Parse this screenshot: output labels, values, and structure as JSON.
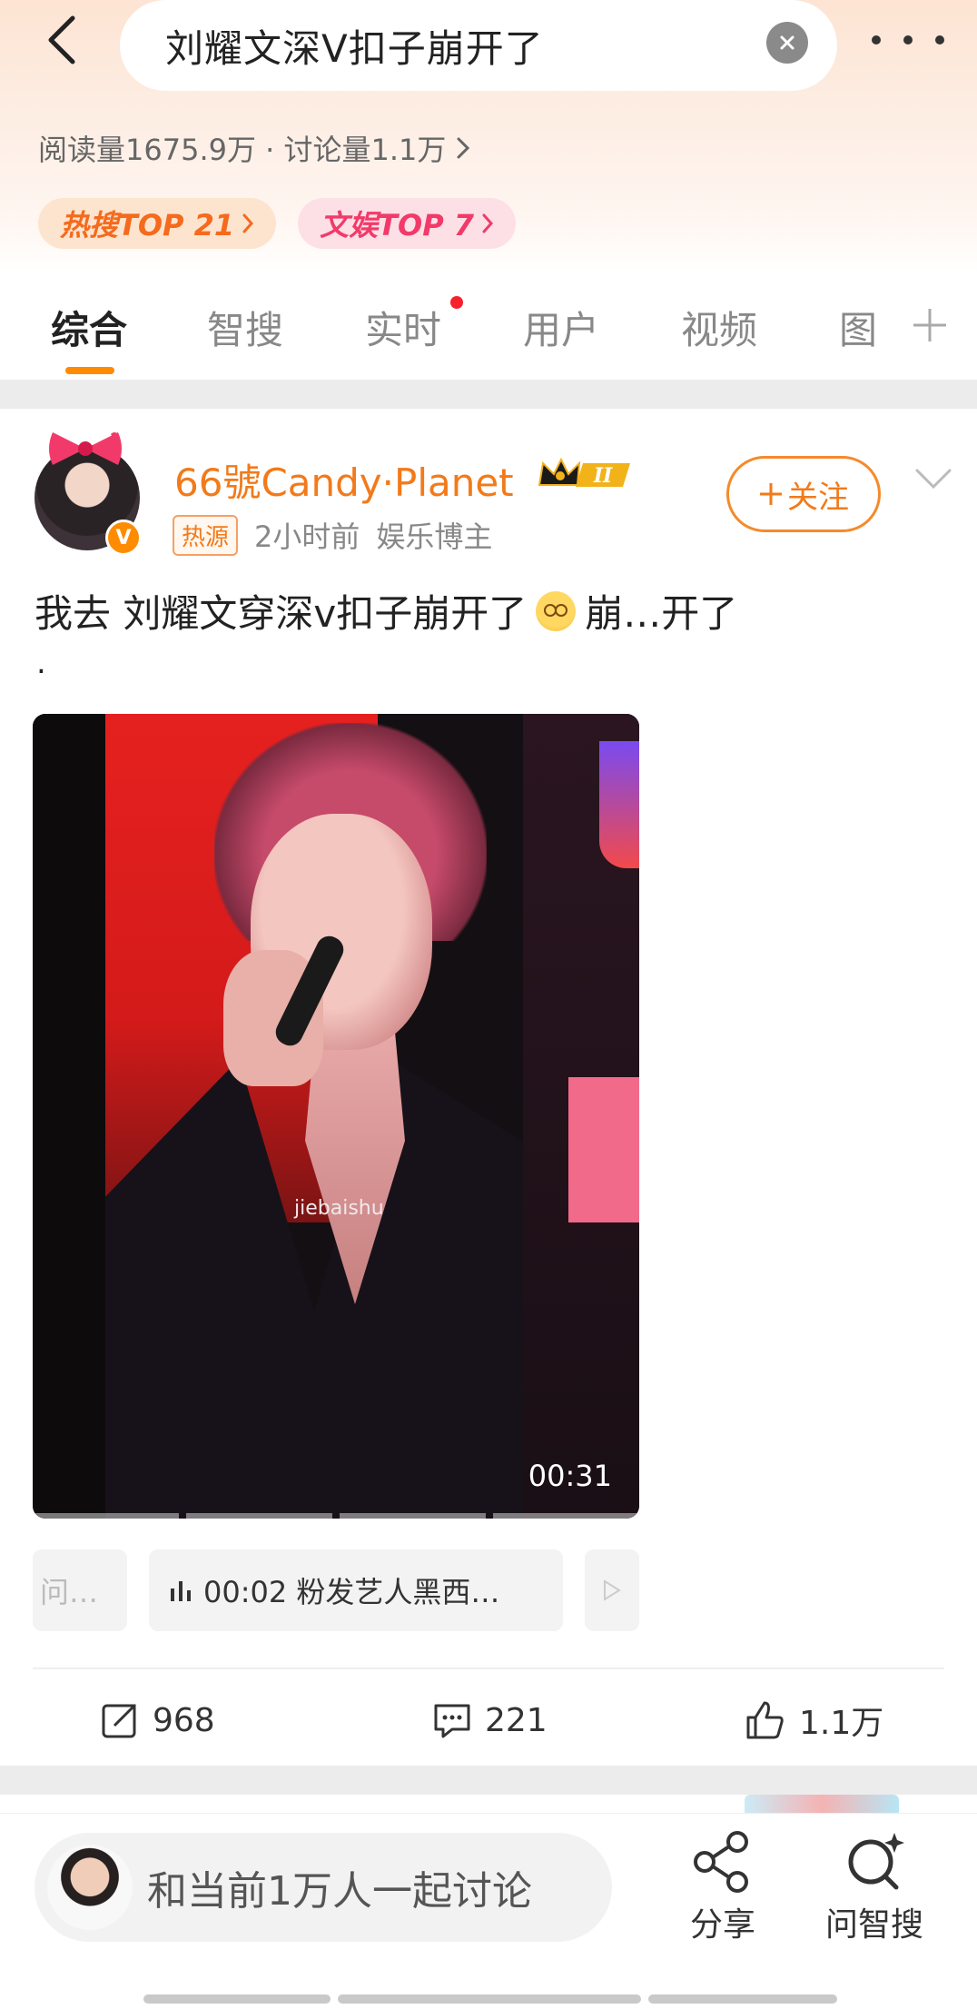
{
  "header": {
    "search_query": "刘耀文深V扣子崩开了",
    "stats": "阅读量1675.9万 · 讨论量1.1万",
    "badges": [
      {
        "label": "热搜TOP 21",
        "color": "#f56a1c"
      },
      {
        "label": "文娱TOP 7",
        "color": "#f23a6a"
      }
    ]
  },
  "tabs": [
    {
      "label": "综合",
      "active": true
    },
    {
      "label": "智搜"
    },
    {
      "label": "实时",
      "has_red_dot": true
    },
    {
      "label": "用户"
    },
    {
      "label": "视频"
    },
    {
      "label": "图"
    }
  ],
  "post": {
    "user_name": "66號Candy·Planet",
    "crown_level": "II",
    "hot_tag": "热源",
    "time": "2小时前",
    "category": "娱乐博主",
    "follow_label": "关注",
    "text_before_emoji": "我去 刘耀文穿深v扣子崩开了",
    "text_after_emoji": "崩…开了",
    "trailing_dot": ".",
    "video": {
      "watermark": "jiebaishu",
      "duration": "00:31"
    },
    "chips": {
      "left_partial": "问…",
      "main": "00:02 粉发艺人黑西…"
    },
    "actions": {
      "repost_count": "968",
      "comment_count": "221",
      "like_count": "1.1万"
    }
  },
  "bottom_bar": {
    "discuss_placeholder": "和当前1万人一起讨论",
    "share_label": "分享",
    "ask_label": "问智搜"
  },
  "colors": {
    "accent_orange": "#f27a1a",
    "tab_underline": "#ff8a00",
    "red_dot": "#f5222d"
  }
}
